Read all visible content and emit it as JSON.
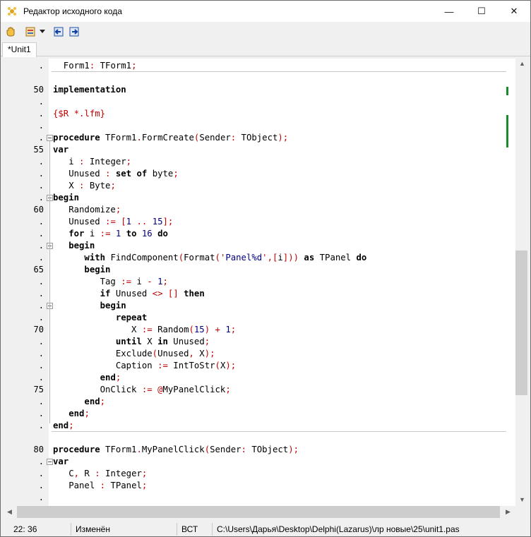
{
  "window": {
    "title": "Редактор исходного кода",
    "minimize": "—",
    "maximize": "☐",
    "close": "✕"
  },
  "toolbar": {
    "items": [
      {
        "name": "hand-icon"
      },
      {
        "name": "form-icon"
      },
      {
        "name": "dropdown-arrow-icon"
      },
      {
        "name": "jump-back-icon"
      },
      {
        "name": "jump-forward-icon"
      }
    ]
  },
  "tabs": [
    {
      "label": "*Unit1"
    }
  ],
  "gutter": [
    ".",
    "50",
    ".",
    ".",
    ".",
    ".",
    "55",
    ".",
    ".",
    ".",
    ".",
    "60",
    ".",
    ".",
    ".",
    ".",
    "65",
    ".",
    ".",
    ".",
    ".",
    "70",
    ".",
    ".",
    ".",
    ".",
    "75",
    ".",
    ".",
    ".",
    "80",
    ".",
    ".",
    ".",
    "."
  ],
  "code": [
    "  Form1: TForm1;",
    "implementation",
    "",
    "{$R *.lfm}",
    "",
    "procedure TForm1.FormCreate(Sender: TObject);",
    "var",
    "   i : Integer;",
    "   Unused : set of byte;",
    "   X : Byte;",
    "begin",
    "   Randomize;",
    "   Unused := [1 .. 15];",
    "   for i := 1 to 16 do",
    "   begin",
    "      with FindComponent(Format('Panel%d',[i])) as TPanel do",
    "      begin",
    "         Tag := i - 1;",
    "         if Unused <> [] then",
    "         begin",
    "            repeat",
    "               X := Random(15) + 1;",
    "            until X in Unused;",
    "            Exclude(Unused, X);",
    "            Caption := IntToStr(X);",
    "         end;",
    "         OnClick := @MyPanelClick;",
    "      end;",
    "   end;",
    "end;",
    "procedure TForm1.MyPanelClick(Sender: TObject);",
    "var",
    "   C, R : Integer;",
    "   Panel : TPanel;",
    ""
  ],
  "status": {
    "position": "22: 36",
    "modified": "Изменён",
    "mode": "ВСТ",
    "path": "C:\\Users\\Дарья\\Desktop\\Delphi(Lazarus)\\лр новые\\25\\unit1.pas"
  },
  "colors": {
    "keyword": "#000000",
    "symbol": "#c00000",
    "string": "#000080",
    "modified_marker": "#1a8a2e"
  }
}
